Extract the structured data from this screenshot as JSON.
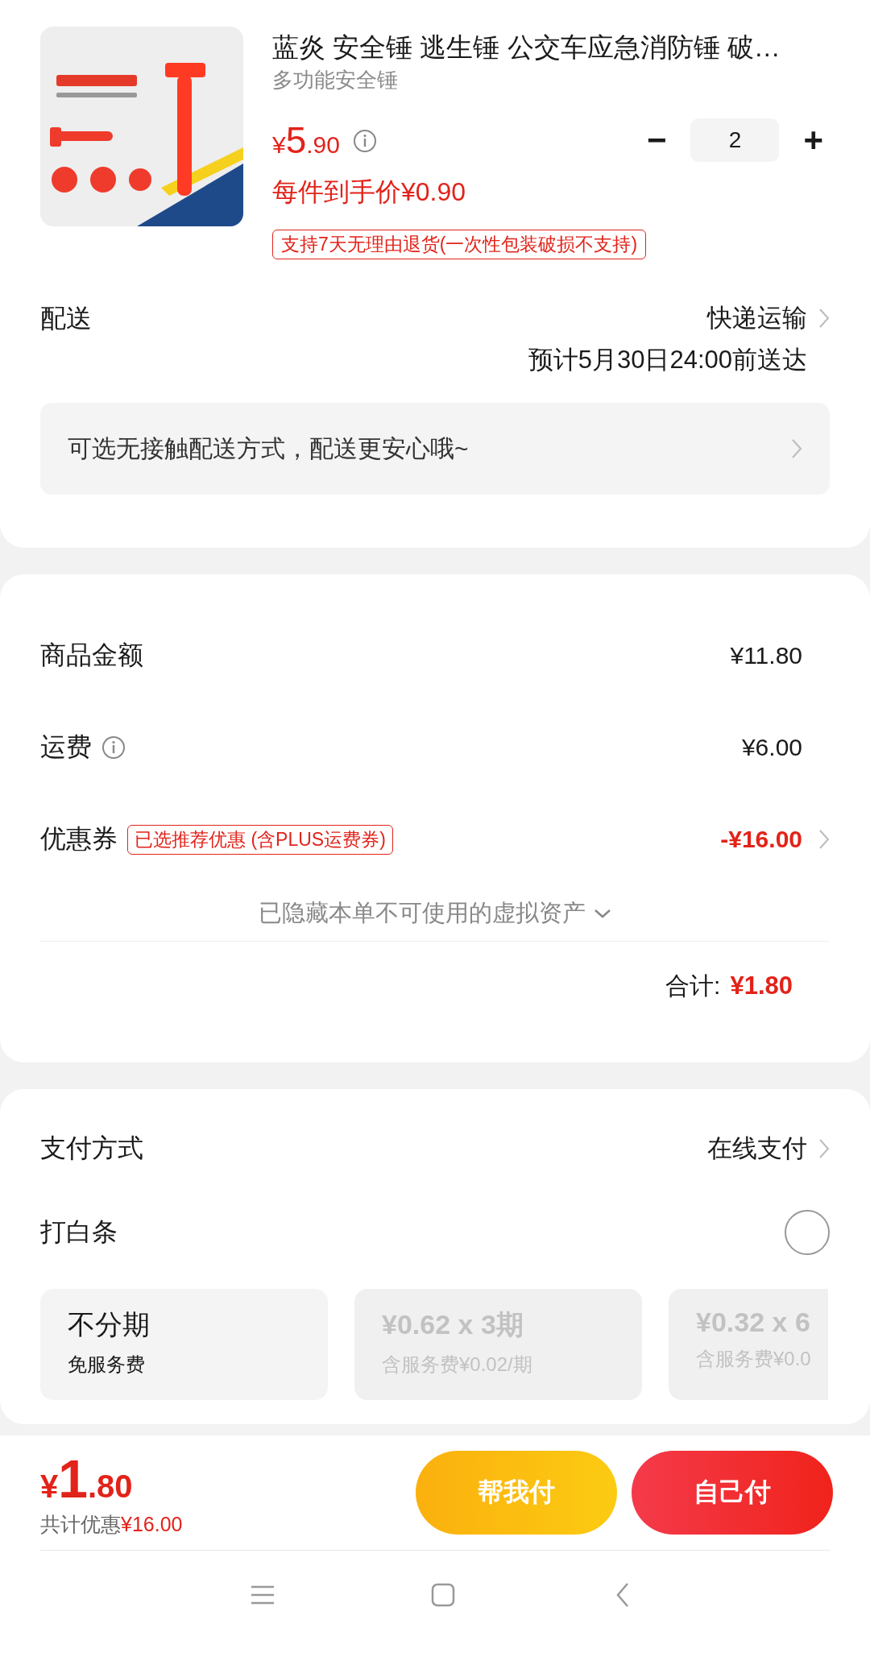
{
  "product": {
    "title": "蓝炎 安全锤 逃生锤 公交车应急消防锤 破…",
    "subtitle": "多功能安全锤",
    "currency": "¥",
    "price_int": "5",
    "price_dec": ".90",
    "unit_price": "每件到手价¥0.90",
    "minus": "−",
    "quantity": "2",
    "plus": "+",
    "return_tag": "支持7天无理由退货(一次性包装破损不支持)"
  },
  "delivery": {
    "label": "配送",
    "method": "快递运输",
    "eta": "预计5月30日24:00前送达",
    "notice": "可选无接触配送方式，配送更安心哦~"
  },
  "summary": {
    "rows": [
      {
        "kind": "plain",
        "label": "商品金额",
        "value": "¥11.80"
      },
      {
        "kind": "info",
        "label": "运费",
        "value": "¥6.00"
      },
      {
        "kind": "coupon",
        "label": "优惠券",
        "tag": "已选推荐优惠 (含PLUS运费券)",
        "value": "-¥16.00"
      }
    ],
    "hidden_assets": "已隐藏本单不可使用的虚拟资产",
    "total_label": "合计:",
    "total_value": "¥1.80"
  },
  "payment": {
    "label": "支付方式",
    "method": "在线支付",
    "baitiao": {
      "label": "打白条",
      "checked": false
    },
    "plans": [
      {
        "title": "不分期",
        "subtitle": "免服务费",
        "disabled": false
      },
      {
        "title": "¥0.62 x 3期",
        "subtitle": "含服务费¥0.02/期",
        "disabled": true
      },
      {
        "title": "¥0.32 x 6",
        "subtitle": "含服务费¥0.0",
        "disabled": true
      }
    ]
  },
  "footer": {
    "currency": "¥",
    "amount_int": "1",
    "amount_dec": ".80",
    "savings_label": "共计优惠",
    "savings_value": "¥16.00",
    "buttons": [
      {
        "kind": "friend",
        "label": "帮我付"
      },
      {
        "kind": "self",
        "label": "自己付"
      }
    ]
  }
}
